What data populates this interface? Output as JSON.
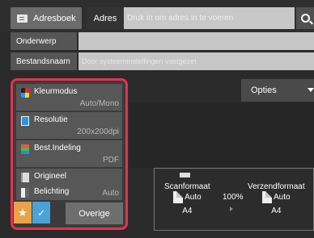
{
  "top": {
    "address_book_label": "Adresboek",
    "address_label": "Adres",
    "address_placeholder": "Druk in om adres in te voeren"
  },
  "fields": {
    "subject_label": "Onderwerp",
    "subject_value": "",
    "filename_label": "Bestandsnaam",
    "filename_placeholder": "Door systeeminstellingen vastgezet"
  },
  "modes": [
    {
      "label": "Kleurmodus",
      "value": "Auto/Mono",
      "icon": "color-mode-icon"
    },
    {
      "label": "Resolutie",
      "value": "200x200dpi",
      "icon": "resolution-icon"
    },
    {
      "label": "Best.Indeling",
      "value": "PDF",
      "icon": "file-format-icon"
    },
    {
      "label": "Origineel",
      "value": "",
      "icon": "original-icon"
    },
    {
      "label": "Belichting",
      "value": "Auto",
      "icon": "exposure-icon"
    }
  ],
  "bottom": {
    "favorite_symbol": "★",
    "check_symbol": "✓",
    "other_label": "Overige"
  },
  "options_label": "Opties",
  "summary": {
    "scan_label": "Scanformaat",
    "scan_mode": "Auto",
    "scan_size": "A4",
    "zoom": "100%",
    "send_label": "Verzendformaat",
    "send_mode": "Auto",
    "send_size": "A4"
  },
  "colors": {
    "highlight": "#e3324e",
    "favorite": "#e9a24a",
    "check": "#4aa3d7"
  }
}
